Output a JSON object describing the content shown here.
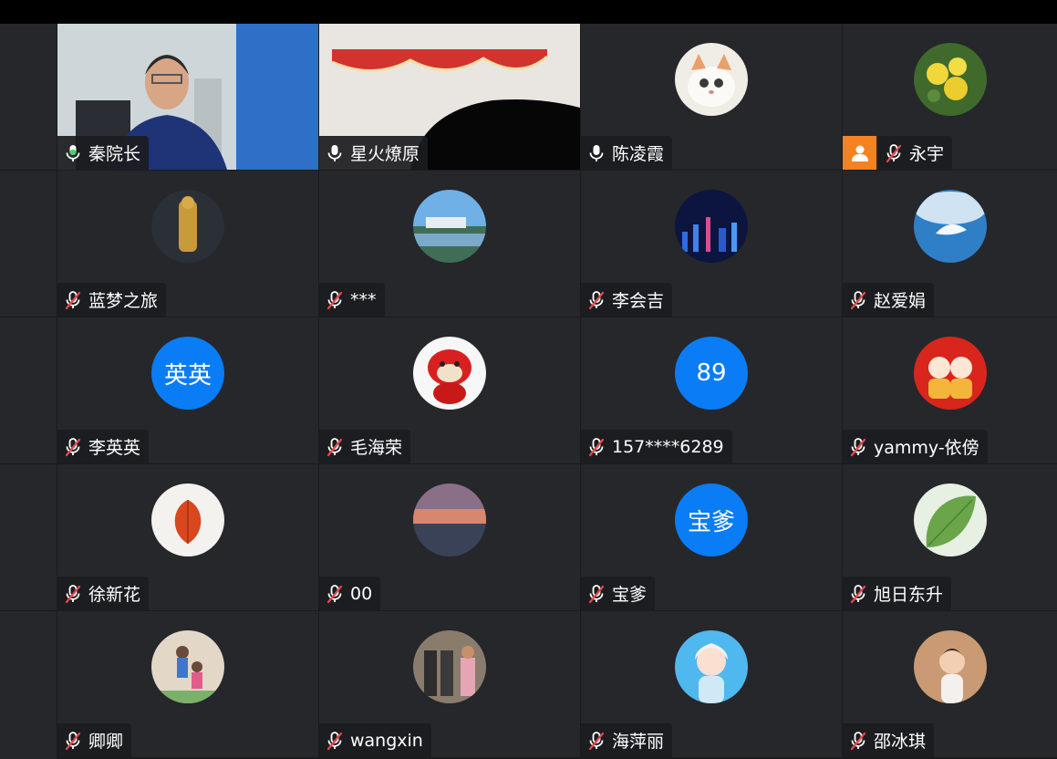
{
  "participants": [
    {
      "name": "秦院长",
      "mic": "active",
      "kind": "video-person"
    },
    {
      "name": "星火燎原",
      "mic": "on",
      "kind": "video-room"
    },
    {
      "name": "陈凌霞",
      "mic": "on",
      "kind": "avatar",
      "avatar_icon": "cat-photo"
    },
    {
      "name": "永宇",
      "mic": "muted",
      "kind": "avatar",
      "avatar_icon": "yellow-flower-photo",
      "badge": "user-icon"
    },
    {
      "name": "蓝梦之旅",
      "mic": "muted",
      "kind": "avatar",
      "avatar_icon": "golden-statue-photo"
    },
    {
      "name": "***",
      "mic": "muted",
      "kind": "avatar",
      "avatar_icon": "lake-building-photo"
    },
    {
      "name": "李会吉",
      "mic": "muted",
      "kind": "avatar",
      "avatar_icon": "night-city-photo"
    },
    {
      "name": "赵爱娟",
      "mic": "muted",
      "kind": "avatar",
      "avatar_icon": "feather-water-photo"
    },
    {
      "name": "李英英",
      "mic": "muted",
      "kind": "text-avatar",
      "avatar_text": "英英"
    },
    {
      "name": "毛海荣",
      "mic": "muted",
      "kind": "avatar",
      "avatar_icon": "tiger-toy-photo"
    },
    {
      "name": "157****6289",
      "mic": "muted",
      "kind": "text-avatar",
      "avatar_text": "89"
    },
    {
      "name": "yammy-依傍",
      "mic": "muted",
      "kind": "avatar",
      "avatar_icon": "festive-cartoon-photo"
    },
    {
      "name": "徐新花",
      "mic": "muted",
      "kind": "avatar",
      "avatar_icon": "red-lantern-plant-photo"
    },
    {
      "name": "00",
      "mic": "muted",
      "kind": "avatar",
      "avatar_icon": "sunset-sea-photo"
    },
    {
      "name": "宝爹",
      "mic": "muted",
      "kind": "text-avatar",
      "avatar_text": "宝爹"
    },
    {
      "name": "旭日东升",
      "mic": "muted",
      "kind": "avatar",
      "avatar_icon": "green-leaf-photo"
    },
    {
      "name": "卿卿",
      "mic": "muted",
      "kind": "avatar",
      "avatar_icon": "family-photo"
    },
    {
      "name": "wangxin",
      "mic": "muted",
      "kind": "avatar",
      "avatar_icon": "statues-people-photo"
    },
    {
      "name": "海萍丽",
      "mic": "muted",
      "kind": "avatar",
      "avatar_icon": "anime-girl-photo"
    },
    {
      "name": "邵冰琪",
      "mic": "muted",
      "kind": "avatar",
      "avatar_icon": "child-photo"
    }
  ],
  "colors": {
    "tile_bg": "#25272b",
    "active_border": "#41d36e",
    "text_avatar_bg": "#0a7cf5",
    "muted_mic": "#e5484d",
    "user_badge": "#f58220"
  }
}
